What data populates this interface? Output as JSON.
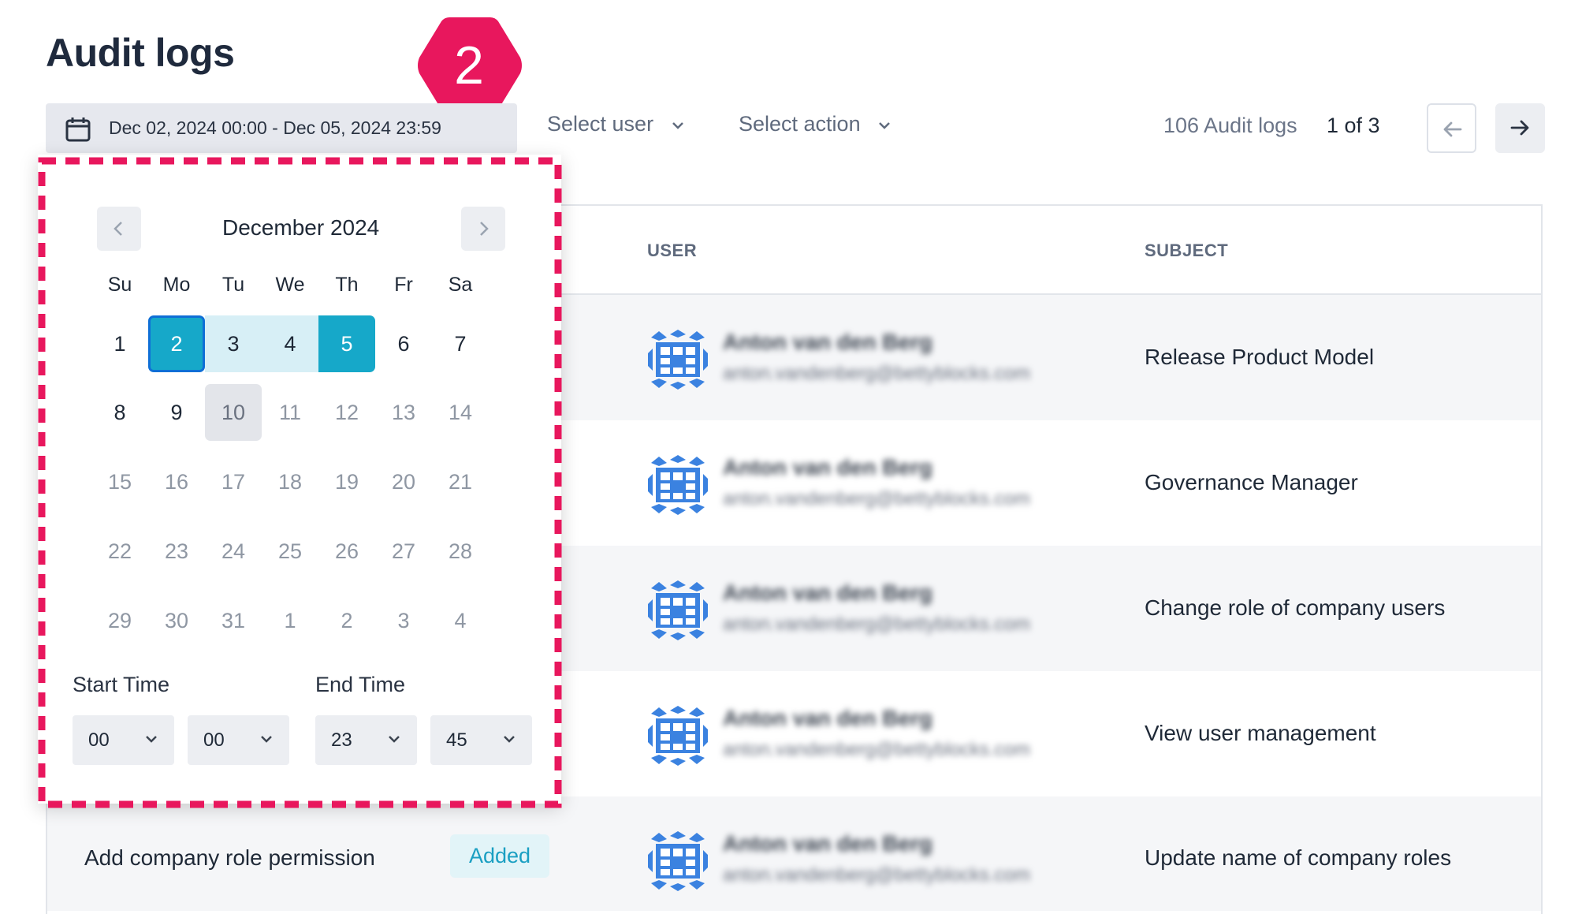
{
  "page": {
    "title": "Audit logs",
    "step_number": "2"
  },
  "filters": {
    "date_range": "Dec 02, 2024 00:00 - Dec 05, 2024 23:59",
    "select_user": "Select user",
    "select_action": "Select action"
  },
  "pagination": {
    "count_label": "106 Audit logs",
    "page_label": "1 of 3"
  },
  "table": {
    "columns": {
      "user": "USER",
      "subject": "SUBJECT"
    },
    "rows": [
      {
        "user_name": "Anton van den Berg",
        "user_email": "anton.vandenberg@bettyblocks.com",
        "subject": "Release Product Model"
      },
      {
        "user_name": "Anton van den Berg",
        "user_email": "anton.vandenberg@bettyblocks.com",
        "subject": "Governance Manager"
      },
      {
        "user_name": "Anton van den Berg",
        "user_email": "anton.vandenberg@bettyblocks.com",
        "subject": "Change role of company users"
      },
      {
        "user_name": "Anton van den Berg",
        "user_email": "anton.vandenberg@bettyblocks.com",
        "subject": "View user management"
      },
      {
        "user_name": "Anton van den Berg",
        "user_email": "anton.vandenberg@bettyblocks.com",
        "subject": "Update name of company roles",
        "action": "Add company role permission",
        "status": "Added"
      }
    ]
  },
  "calendar": {
    "month_label": "December 2024",
    "weekdays": [
      "Su",
      "Mo",
      "Tu",
      "We",
      "Th",
      "Fr",
      "Sa"
    ],
    "weeks": [
      [
        "1",
        "2",
        "3",
        "4",
        "5",
        "6",
        "7"
      ],
      [
        "8",
        "9",
        "10",
        "11",
        "12",
        "13",
        "14"
      ],
      [
        "15",
        "16",
        "17",
        "18",
        "19",
        "20",
        "21"
      ],
      [
        "22",
        "23",
        "24",
        "25",
        "26",
        "27",
        "28"
      ],
      [
        "29",
        "30",
        "31",
        "1",
        "2",
        "3",
        "4"
      ]
    ],
    "start_time_label": "Start Time",
    "end_time_label": "End Time",
    "start_hour": "00",
    "start_minute": "00",
    "end_hour": "23",
    "end_minute": "45"
  },
  "colors": {
    "accent": "#16a8c9",
    "range": "#d7eff6",
    "highlight": "#e8175d",
    "avatar": "#3b82e0"
  },
  "icons": {
    "date_range": "calendar-icon",
    "dropdown": "chevron-down-icon",
    "prev": "arrow-left-icon",
    "next": "arrow-right-icon"
  }
}
